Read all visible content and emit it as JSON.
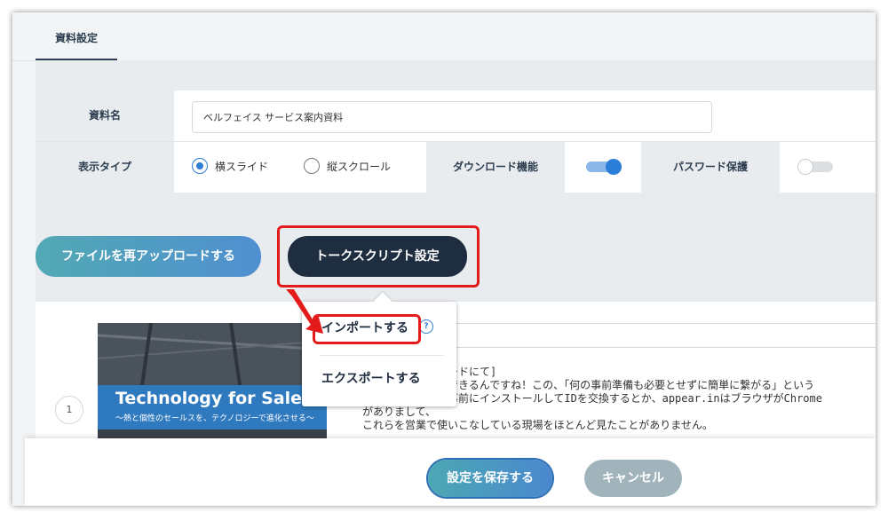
{
  "tabs": [
    {
      "label": "資料設定",
      "active": true
    }
  ],
  "form": {
    "name_label": "資料名",
    "name_value": "ベルフェイス サービス案内資料",
    "display_type_label": "表示タイプ",
    "display_options": [
      {
        "label": "横スライド",
        "selected": true
      },
      {
        "label": "縦スクロール",
        "selected": false
      }
    ],
    "download_label": "ダウンロード機能",
    "download_enabled": true,
    "password_label": "パスワード保護",
    "password_enabled": false
  },
  "actions": {
    "reupload_label": "ファイルを再アップロードする",
    "talkscript_label": "トークスクリプト設定"
  },
  "dropdown": {
    "import_label": "インポートする",
    "export_label": "エクスポートする",
    "help_glyph": "?"
  },
  "slide": {
    "number": "1",
    "title": "Technology for Sales",
    "subtitle": "〜熱と個性のセールスを、テクノロジーで進化させる〜"
  },
  "script": {
    "lines": [
      "ードにて]",
      "できるんですね！この、「何の事前準備も必要とせずに簡単に繋がる」という",
      "例えばスカイプは事前にインストールしてIDを交換するとか、appear.inはブラウザがChrome",
      "がありまして、",
      "これらを営業で使いこなしている現場をほとんど見たことがありません。"
    ]
  },
  "footer": {
    "save_label": "設定を保存する",
    "cancel_label": "キャンセル"
  },
  "colors": {
    "accent": "#2d7fd6",
    "dark_button": "#1f2d40",
    "highlight": "#e41b1b"
  }
}
